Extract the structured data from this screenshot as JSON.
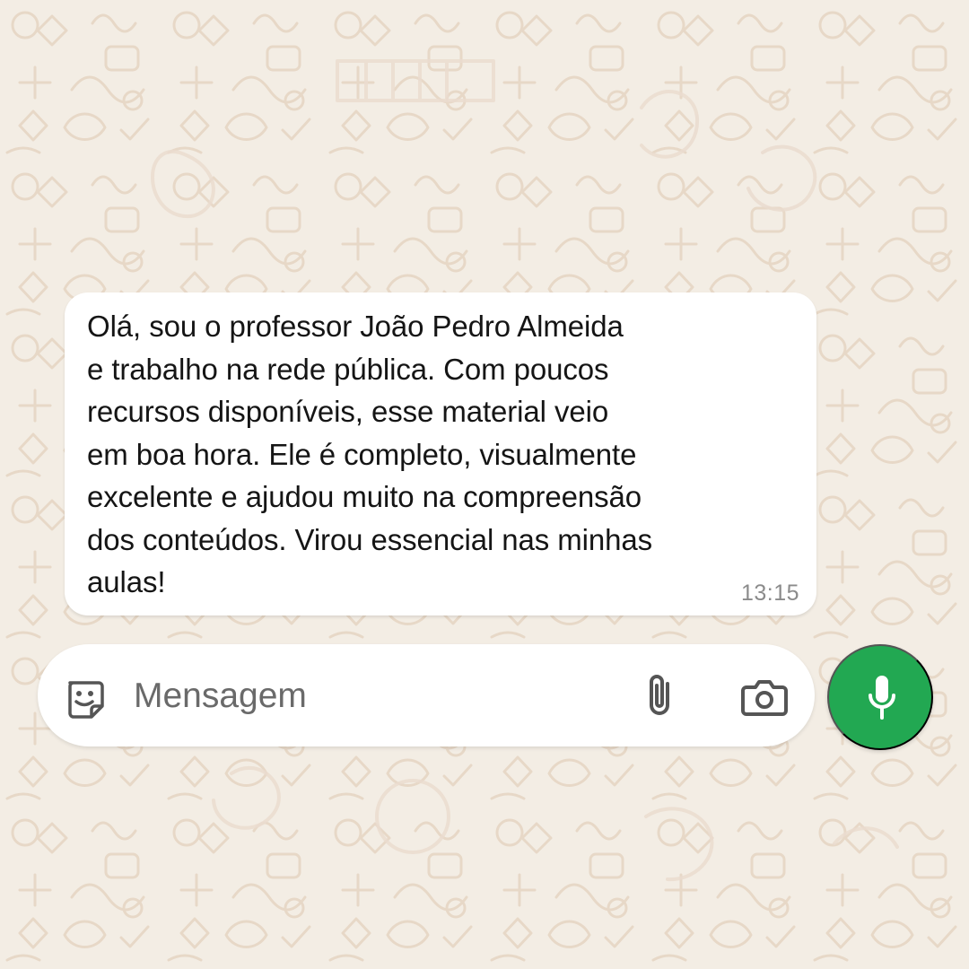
{
  "conversation": {
    "message": {
      "lines": [
        "Olá, sou o professor João Pedro Almeida",
        "e trabalho na rede pública. Com poucos",
        "recursos disponíveis, esse material veio",
        "em boa hora. Ele é completo, visualmente",
        "excelente e ajudou muito na compreensão",
        "dos conteúdos. Virou essencial nas minhas",
        "aulas!"
      ],
      "time": "13:15"
    }
  },
  "composer": {
    "placeholder": "Mensagem",
    "left_icon": "sticker-icon",
    "right_icons": [
      "attachment-icon",
      "camera-icon"
    ]
  },
  "mic_button": {
    "icon": "mic-icon",
    "color": "#22a852"
  },
  "theme": {
    "wallpaper": "#f3ede4",
    "doodles": "#e7d8c7",
    "bubble": "#ffffff"
  }
}
